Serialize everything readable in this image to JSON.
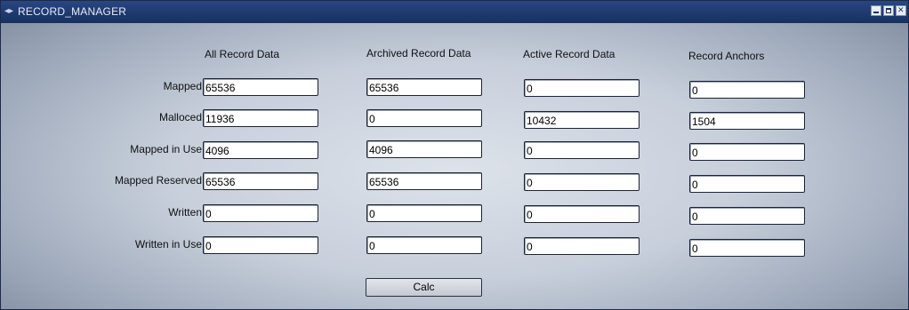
{
  "window": {
    "title": "RECORD_MANAGER"
  },
  "columns": [
    "All Record Data",
    "Archived Record Data",
    "Active Record Data",
    "Record Anchors"
  ],
  "rows": [
    {
      "label": "Mapped",
      "values": [
        "65536",
        "65536",
        "0",
        "0"
      ]
    },
    {
      "label": "Malloced",
      "values": [
        "11936",
        "0",
        "10432",
        "1504"
      ]
    },
    {
      "label": "Mapped in Use",
      "values": [
        "4096",
        "4096",
        "0",
        "0"
      ]
    },
    {
      "label": "Mapped Reserved",
      "values": [
        "65536",
        "65536",
        "0",
        "0"
      ]
    },
    {
      "label": "Written",
      "values": [
        "0",
        "0",
        "0",
        "0"
      ]
    },
    {
      "label": "Written in Use",
      "values": [
        "0",
        "0",
        "0",
        "0"
      ]
    }
  ],
  "buttons": {
    "calc": "Calc"
  }
}
